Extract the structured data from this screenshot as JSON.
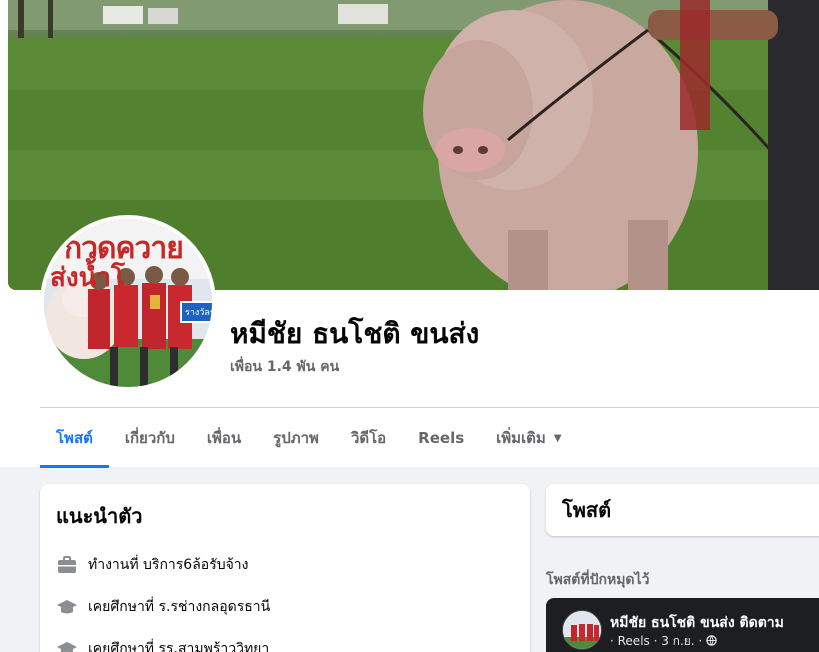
{
  "profile": {
    "name": "หมีชัย ธนโชติ ขนส่ง",
    "friends": "เพื่อน 1.4 พัน คน",
    "avatar_banner_line1": "กวดควาย",
    "avatar_banner_line2": "ส่งน้ำโ",
    "avatar_badge": "รางวัลชน"
  },
  "tabs": [
    {
      "label": "โพสต์",
      "active": true
    },
    {
      "label": "เกี่ยวกับ",
      "active": false
    },
    {
      "label": "เพื่อน",
      "active": false
    },
    {
      "label": "รูปภาพ",
      "active": false
    },
    {
      "label": "วิดีโอ",
      "active": false
    },
    {
      "label": "Reels",
      "active": false
    },
    {
      "label": "เพิ่มเติม",
      "active": false
    }
  ],
  "intro": {
    "title": "แนะนำตัว",
    "items": [
      {
        "icon": "briefcase-icon",
        "text": "ทำงานที่ บริการ6ล้อรับจ้าง"
      },
      {
        "icon": "graduation-cap-icon",
        "text": "เคยศึกษาที่ ร.รช่างกลอุดรธานี"
      },
      {
        "icon": "graduation-cap-icon",
        "text": "เคยศึกษาที่ รร.สามพร้าววิทยา"
      }
    ]
  },
  "posts": {
    "title": "โพสต์",
    "pinned_label": "โพสต์ที่ปักหมุดไว้",
    "pinned_post": {
      "author_line": "หมีชัย ธนโชติ ขนส่ง ติดตาม",
      "meta": "· Reels · 3 ก.ย. ·"
    }
  },
  "colors": {
    "accent": "#1877f2",
    "page_bg": "#f0f2f5",
    "secondary_text": "#65676b"
  }
}
